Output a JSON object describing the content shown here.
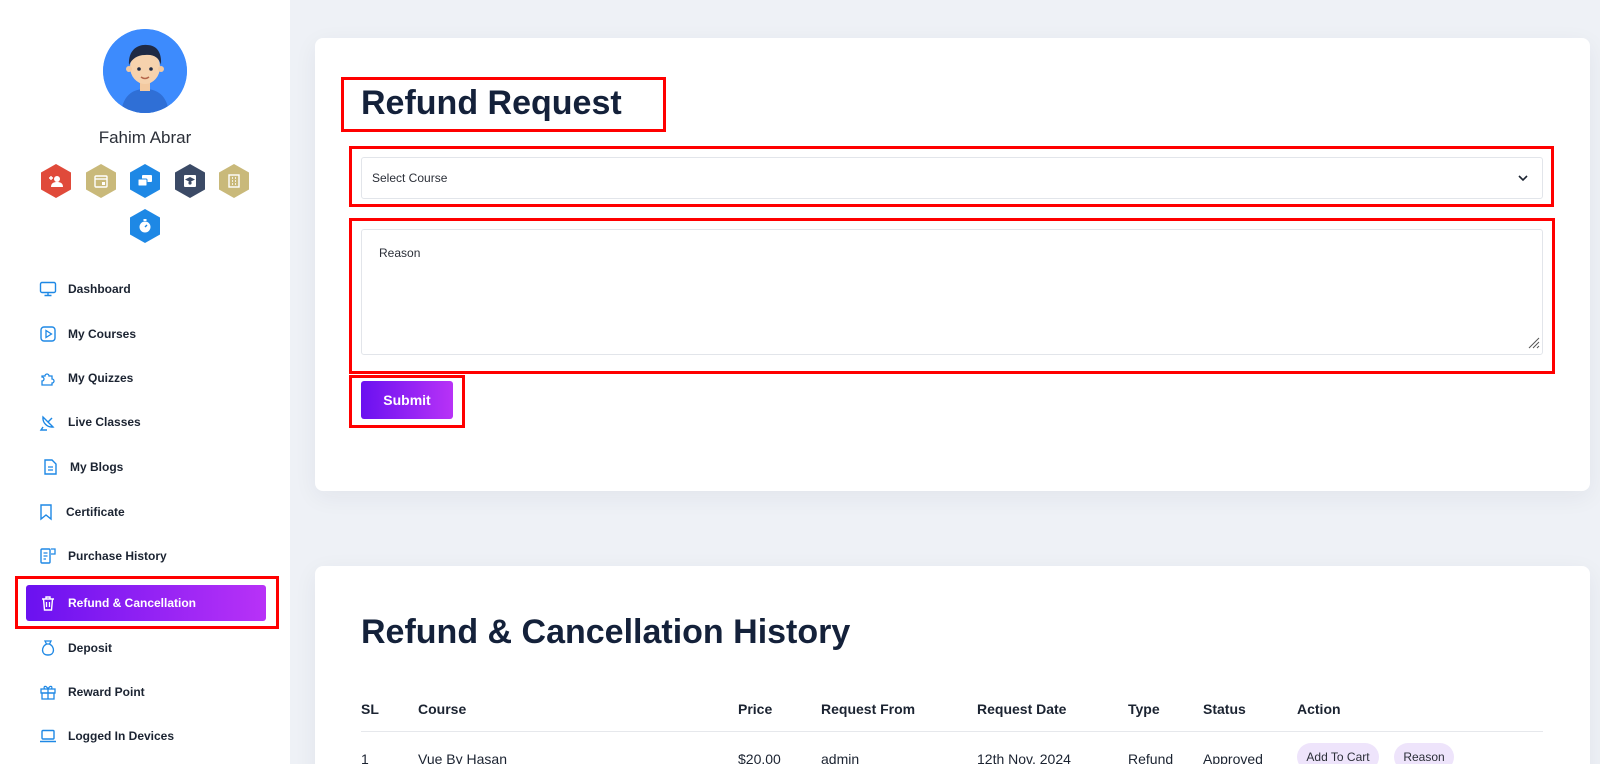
{
  "user": {
    "name": "Fahim Abrar"
  },
  "badges": [
    {
      "icon": "add-user-icon",
      "color": "#e04a3a"
    },
    {
      "icon": "calendar-icon",
      "color": "#c9b97a"
    },
    {
      "icon": "chat-icon",
      "color": "#1e88e5"
    },
    {
      "icon": "graduate-icon",
      "color": "#3b4a66"
    },
    {
      "icon": "building-icon",
      "color": "#c9b97a"
    },
    {
      "icon": "stopwatch-icon",
      "color": "#1e88e5"
    }
  ],
  "sidebar": {
    "items": [
      {
        "label": "Dashboard",
        "icon": "monitor-icon"
      },
      {
        "label": "My Courses",
        "icon": "play-square-icon"
      },
      {
        "label": "My Quizzes",
        "icon": "puzzle-icon"
      },
      {
        "label": "Live Classes",
        "icon": "satellite-dish-icon"
      },
      {
        "label": "My Blogs",
        "icon": "document-icon"
      },
      {
        "label": "Certificate",
        "icon": "bookmark-icon"
      },
      {
        "label": "Purchase History",
        "icon": "receipt-icon"
      },
      {
        "label": "Refund & Cancellation",
        "icon": "trash-icon",
        "active": true
      },
      {
        "label": "Deposit",
        "icon": "money-bag-icon"
      },
      {
        "label": "Reward Point",
        "icon": "gift-icon"
      },
      {
        "label": "Logged In Devices",
        "icon": "laptop-icon"
      }
    ]
  },
  "refund_form": {
    "title": "Refund Request",
    "course_select": {
      "value": "Select Course"
    },
    "reason": {
      "placeholder": "Reason"
    },
    "submit_label": "Submit"
  },
  "history": {
    "title": "Refund & Cancellation History",
    "columns": [
      "SL",
      "Course",
      "Price",
      "Request From",
      "Request Date",
      "Type",
      "Status",
      "Action"
    ],
    "rows": [
      {
        "sl": "1",
        "course": "Vue By Hasan",
        "price": "$20.00",
        "request_from": "admin",
        "request_date": "12th Nov, 2024",
        "type": "Refund",
        "status": "Approved",
        "actions": [
          "Add To Cart",
          "Reason"
        ]
      }
    ]
  },
  "colors": {
    "accent_start": "#6a11f0",
    "accent_end": "#b832f7",
    "highlight_box": "#ff0000",
    "page_bg": "#eef1f6"
  }
}
